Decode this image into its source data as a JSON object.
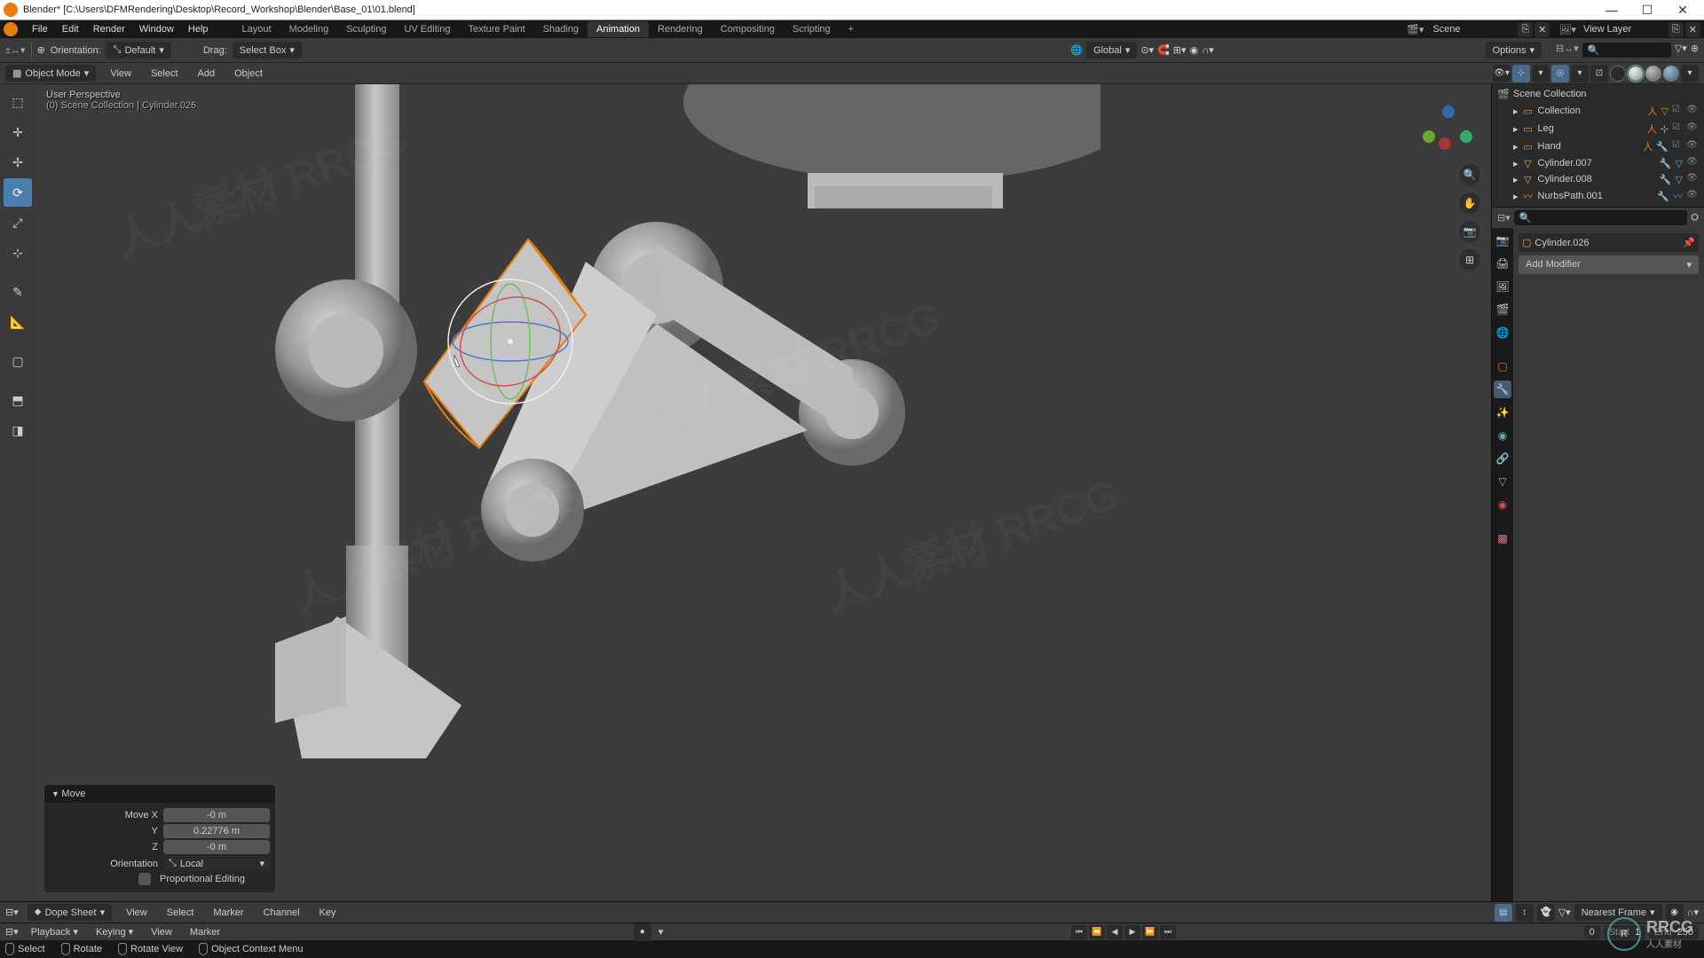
{
  "window_title": "Blender* [C:\\Users\\DFMRendering\\Desktop\\Record_Workshop\\Blender\\Base_01\\01.blend]",
  "top_menu": [
    "File",
    "Edit",
    "Render",
    "Window",
    "Help"
  ],
  "workspace_tabs": [
    "Layout",
    "Modeling",
    "Sculpting",
    "UV Editing",
    "Texture Paint",
    "Shading",
    "Animation",
    "Rendering",
    "Compositing",
    "Scripting"
  ],
  "workspace_active": "Animation",
  "scene_label": "Scene",
  "view_layer_label": "View Layer",
  "tool_header": {
    "orientation_label": "Orientation:",
    "orientation_value": "Default",
    "drag_label": "Drag:",
    "drag_value": "Select Box",
    "transform_orientation": "Global",
    "options_label": "Options"
  },
  "view_header": {
    "mode": "Object Mode",
    "menus": [
      "View",
      "Select",
      "Add",
      "Object"
    ]
  },
  "viewport": {
    "view_label": "User Perspective",
    "collection_label": "(0) Scene Collection | Cylinder.026"
  },
  "operator_panel": {
    "title": "Move",
    "rows": [
      {
        "label": "Move X",
        "value": "-0 m"
      },
      {
        "label": "Y",
        "value": "0.22776 m"
      },
      {
        "label": "Z",
        "value": "-0 m"
      }
    ],
    "orientation_label": "Orientation",
    "orientation_value": "Local",
    "proportional_label": "Proportional Editing"
  },
  "outliner": {
    "search_placeholder": "",
    "items": [
      {
        "indent": 0,
        "icon": "scene",
        "label": "Scene Collection",
        "type": "collection"
      },
      {
        "indent": 1,
        "icon": "collection",
        "label": "Collection",
        "type": "collection",
        "icons_right": true
      },
      {
        "indent": 1,
        "icon": "collection",
        "label": "Leg",
        "type": "collection",
        "icons_right": true
      },
      {
        "indent": 1,
        "icon": "collection",
        "label": "Hand",
        "type": "collection",
        "icons_right": true
      },
      {
        "indent": 1,
        "icon": "mesh",
        "label": "Cylinder.007",
        "type": "mesh",
        "icons_right": true
      },
      {
        "indent": 1,
        "icon": "mesh",
        "label": "Cylinder.008",
        "type": "mesh",
        "icons_right": true
      },
      {
        "indent": 1,
        "icon": "curve",
        "label": "NurbsPath.001",
        "type": "curve",
        "icons_right": true
      }
    ]
  },
  "properties": {
    "breadcrumb_object": "Cylinder.026",
    "add_modifier_label": "Add Modifier"
  },
  "dope_sheet": {
    "editor": "Dope Sheet",
    "menus": [
      "View",
      "Select",
      "Marker",
      "Channel",
      "Key"
    ],
    "right_dropdown": "Nearest Frame"
  },
  "timeline": {
    "menus": [
      "Playback",
      "Keying",
      "View",
      "Marker"
    ],
    "current_frame": "0",
    "start_label": "Start",
    "start_value": "1",
    "end_label": "End",
    "end_value": "250"
  },
  "statusbar": {
    "hints": [
      {
        "icon": "mouse-left",
        "label": "Select"
      },
      {
        "icon": "mouse-left",
        "label": "Rotate"
      },
      {
        "icon": "mouse-middle",
        "label": "Rotate View"
      },
      {
        "icon": "mouse-right",
        "label": "Object Context Menu"
      }
    ]
  },
  "watermark_text": "人人素材 RRCG",
  "rrcg_inner": "R",
  "rrcg_text": "RRCG"
}
